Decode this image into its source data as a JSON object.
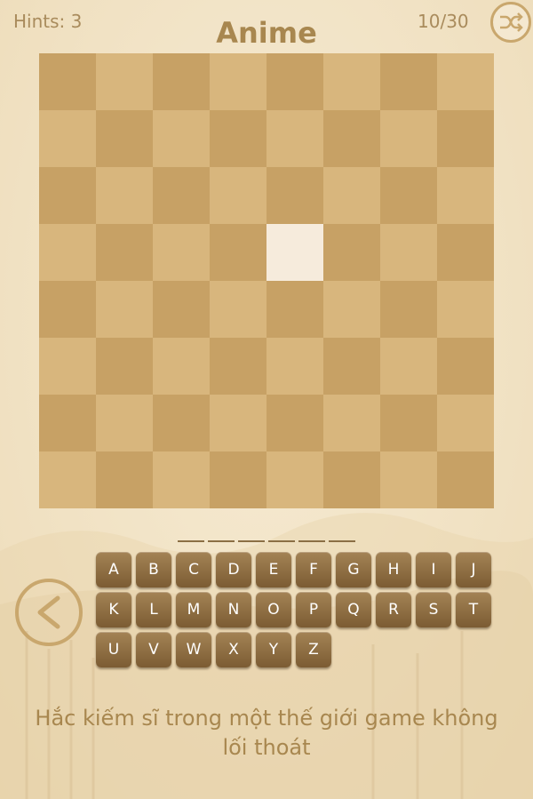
{
  "header": {
    "hints_text": "Hints: 3",
    "title": "Anime",
    "progress_text": "10/30",
    "shuffle_icon": "shuffle-icon"
  },
  "board": {
    "rows": 8,
    "cols": 8,
    "colors": {
      "dark": "#c7a165",
      "light": "#d8b67d",
      "revealed": "#f6ebdc"
    },
    "revealed_tiles": [
      {
        "row": 3,
        "col": 4
      }
    ]
  },
  "answer": {
    "slot_count": 6
  },
  "back_icon": "chevron-left-icon",
  "keyboard": {
    "rows": [
      [
        "A",
        "B",
        "C",
        "D",
        "E",
        "F",
        "G",
        "H",
        "I",
        "J"
      ],
      [
        "K",
        "L",
        "M",
        "N",
        "O",
        "P",
        "Q",
        "R",
        "S",
        "T"
      ],
      [
        "U",
        "V",
        "W",
        "X",
        "Y",
        "Z"
      ]
    ]
  },
  "clue": "Hắc kiếm sĩ trong một thế giới game không lối thoát"
}
